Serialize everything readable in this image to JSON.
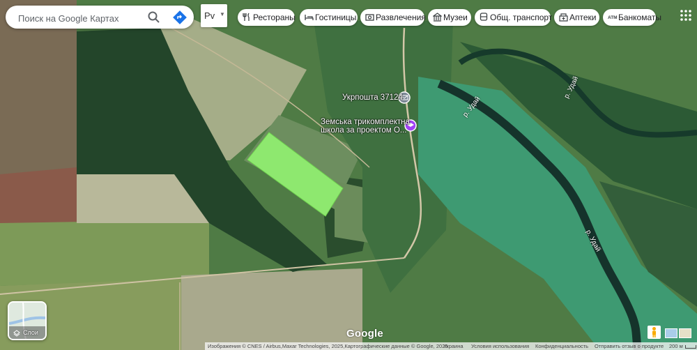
{
  "search": {
    "placeholder": "Поиск на Google Картах"
  },
  "language": {
    "current": "Рv"
  },
  "chips": [
    {
      "label": "Рестораны",
      "icon": "fork-knife-icon"
    },
    {
      "label": "Гостиницы",
      "icon": "bed-icon"
    },
    {
      "label": "Развлечения",
      "icon": "camera-icon"
    },
    {
      "label": "Музеи",
      "icon": "museum-icon"
    },
    {
      "label": "Общ. транспорт",
      "icon": "bus-icon"
    },
    {
      "label": "Аптеки",
      "icon": "pharmacy-icon"
    },
    {
      "label": "Банкоматы",
      "icon": "atm-icon"
    }
  ],
  "map": {
    "pois": [
      {
        "label": "Укрпошта 37124",
        "icon": "mail-icon",
        "color": "#7b8794"
      },
      {
        "label_line1": "Земська трикомплектна",
        "label_line2": "школа за проектом О...",
        "icon": "school-icon",
        "color": "#a142f4"
      }
    ],
    "rivers": [
      "р. Удай",
      "р. Удай",
      "р. Удай"
    ],
    "highlight_color": "#8ee86f"
  },
  "layers": {
    "label": "Слои"
  },
  "logo": "Google",
  "footer": {
    "attribution": "Изображения © CNES / Airbus,Maxar Technologies, 2025,Картографические данные © Google, 2025",
    "country": "Украина",
    "terms": "Условия использования",
    "privacy": "Конфиденциальность",
    "feedback": "Отправить отзыв о продукте",
    "scale": "200 м"
  }
}
